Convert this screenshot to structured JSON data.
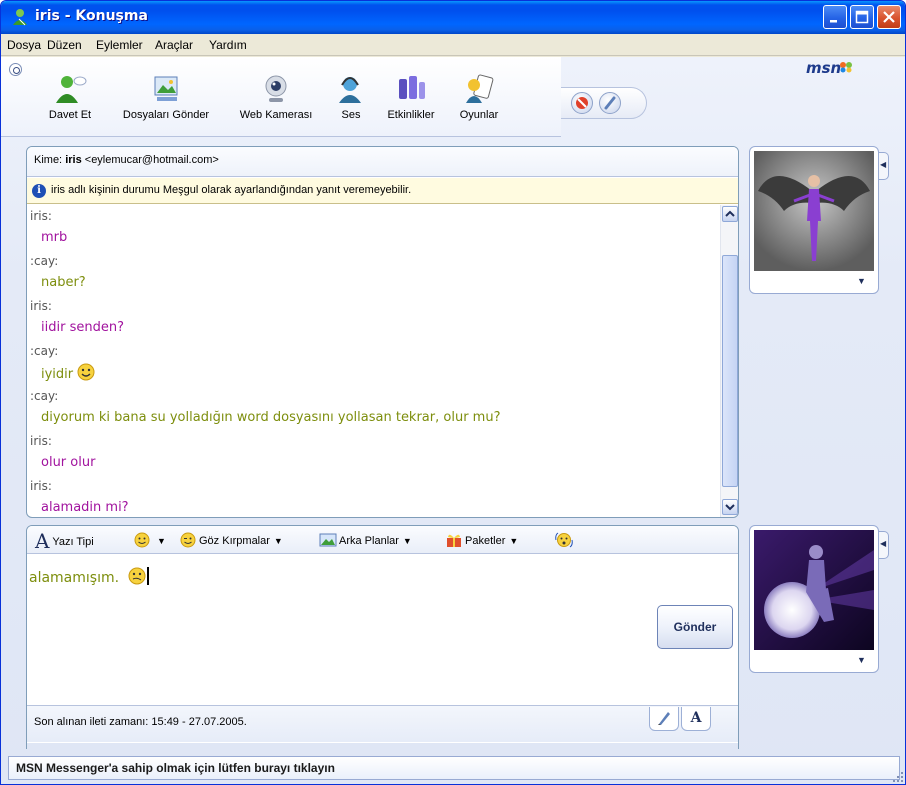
{
  "window": {
    "title": "iris - Konuşma"
  },
  "menu": [
    "Dosya",
    "Düzen",
    "Eylemler",
    "Araçlar",
    "Yardım"
  ],
  "toolbar": {
    "items": [
      {
        "label": "Davet Et",
        "icon": "invite-contact-icon"
      },
      {
        "label": "Dosyaları Gönder",
        "icon": "send-files-icon"
      },
      {
        "label": "Web Kamerası",
        "icon": "webcam-icon"
      },
      {
        "label": "Ses",
        "icon": "voice-icon"
      },
      {
        "label": "Etkinlikler",
        "icon": "activities-icon"
      },
      {
        "label": "Oyunlar",
        "icon": "games-icon"
      }
    ],
    "logo": "msn"
  },
  "conversation": {
    "to_label": "Kime:",
    "to_name": "iris",
    "to_email": "<eylemucar@hotmail.com>",
    "notice": "iris adlı kişinin durumu Meşgul olarak ayarlandığından yanıt veremeyebilir.",
    "messages": [
      {
        "sender": "iris:",
        "text": "mrb",
        "who": "iris"
      },
      {
        "sender": ":cay:",
        "text": "naber?",
        "who": "cay"
      },
      {
        "sender": "iris:",
        "text": "iidir senden?",
        "who": "iris"
      },
      {
        "sender": ":cay:",
        "text": "iyidir",
        "who": "cay",
        "emoticon": "smile"
      },
      {
        "sender": ":cay:",
        "text": "diyorum ki bana su yolladığın word dosyasını yollasan tekrar, olur mu?",
        "who": "cay"
      },
      {
        "sender": "iris:",
        "text": "olur olur",
        "who": "iris"
      },
      {
        "sender": "iris:",
        "text": "alamadin mi?",
        "who": "iris"
      }
    ]
  },
  "format_bar": {
    "font": "Yazı Tipi",
    "winks": "Göz Kırpmalar",
    "backgrounds": "Arka Planlar",
    "packages": "Paketler"
  },
  "compose": {
    "text": "alamamışım.",
    "send_label": "Gönder"
  },
  "status": {
    "last_received": "Son alınan ileti zamanı: 15:49 - 27.07.2005."
  },
  "ad_bar": "MSN Messenger'a sahip olmak için lütfen burayı tıklayın",
  "colors": {
    "iris_text": "#a1139e",
    "cay_text": "#7d8e0d",
    "titlebar": "#0054e3"
  }
}
